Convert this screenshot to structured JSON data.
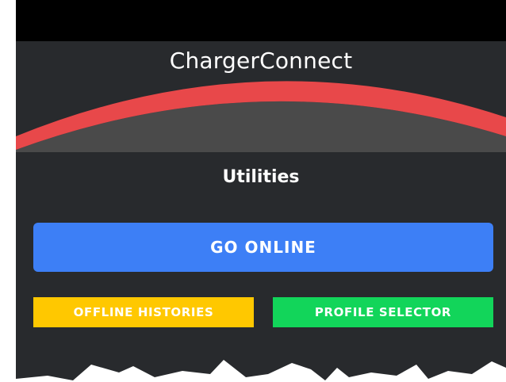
{
  "app": {
    "title": "ChargerConnect"
  },
  "section": {
    "title": "Utilities"
  },
  "buttons": {
    "go_online": "GO ONLINE",
    "offline_histories": "OFFLINE HISTORIES",
    "profile_selector": "PROFILE SELECTOR"
  },
  "colors": {
    "background": "#282a2d",
    "status_bar": "#000000",
    "arc_accent": "#e8484a",
    "arc_fill": "#4a4a4a",
    "primary_button": "#3d7ff6",
    "history_button": "#ffc800",
    "profile_button": "#12d55a"
  }
}
